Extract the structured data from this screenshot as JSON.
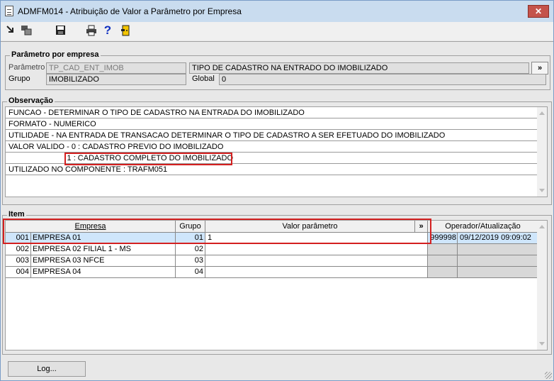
{
  "window": {
    "title": "ADMFM014 - Atribuição de Valor a Parâmetro por Empresa",
    "close_label": "✕"
  },
  "toolbar": {
    "icons": [
      "arrow-icon",
      "windows-icon",
      "save-icon",
      "print-icon",
      "help-icon",
      "exit-icon"
    ],
    "help_glyph": "?"
  },
  "parametro": {
    "group_title": "Parâmetro por empresa",
    "parametro_label": "Parâmetro",
    "parametro_value": "TP_CAD_ENT_IMOB",
    "descricao_value": "TIPO DE CADASTRO NA ENTRADO DO IMOBILIZADO",
    "more_button": "»",
    "grupo_label": "Grupo",
    "grupo_value": "IMOBILIZADO",
    "global_label": "Global",
    "global_value": "0"
  },
  "observacao": {
    "group_title": "Observação",
    "lines": [
      "FUNCAO - DETERMINAR O TIPO DE CADASTRO NA ENTRADA DO IMOBILIZADO",
      "FORMATO - NUMERICO",
      "UTILIDADE - NA ENTRADA DE TRANSACAO DETERMINAR O TIPO DE CADASTRO A SER EFETUADO DO IMOBILIZADO",
      "VALOR VALIDO -  0 : CADASTRO PREVIO DO IMOBILIZADO",
      "                           1 : CADASTRO COMPLETO DO IMOBILIZADO",
      "UTILIZADO NO COMPONENTE : TRAFM051"
    ]
  },
  "item": {
    "group_title": "Item",
    "columns": {
      "empresa": "Empresa",
      "grupo": "Grupo",
      "valor": "Valor parâmetro",
      "valor_more": "»",
      "operador": "Operador/Atualização"
    },
    "rows": [
      {
        "codigo": "001",
        "empresa": "EMPRESA 01",
        "grupo": "01",
        "valor": "1",
        "operador": "999998",
        "atualizacao": "09/12/2019 09:09:02"
      },
      {
        "codigo": "002",
        "empresa": "EMPRESA 02 FILIAL 1 - MS",
        "grupo": "02",
        "valor": "",
        "operador": "",
        "atualizacao": ""
      },
      {
        "codigo": "003",
        "empresa": "EMPRESA 03 NFCE",
        "grupo": "03",
        "valor": "",
        "operador": "",
        "atualizacao": ""
      },
      {
        "codigo": "004",
        "empresa": "EMPRESA 04",
        "grupo": "04",
        "valor": "",
        "operador": "",
        "atualizacao": ""
      }
    ]
  },
  "footer": {
    "log_button": "Log..."
  },
  "colors": {
    "highlight": "#d42020",
    "selected_row": "#cfe6fb",
    "titlebar": "#c9dcef"
  }
}
